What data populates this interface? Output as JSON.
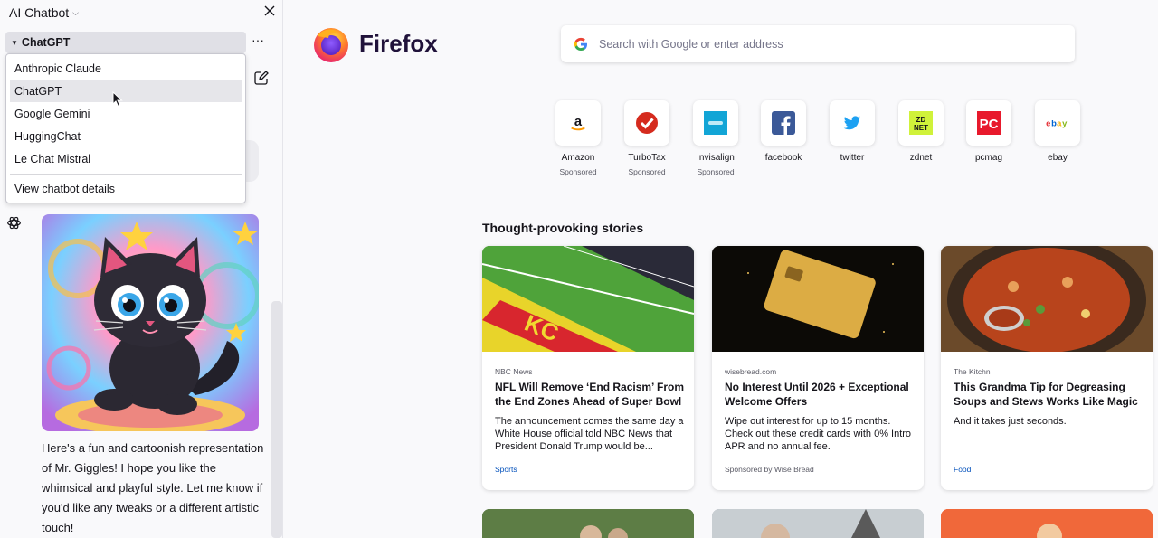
{
  "sidebar": {
    "title": "AI Chatbot",
    "selected_provider": "ChatGPT",
    "more_label": "···",
    "dropdown": {
      "items": [
        "Anthropic Claude",
        "ChatGPT",
        "Google Gemini",
        "HuggingChat",
        "Le Chat Mistral"
      ],
      "selected_index": 1,
      "details_label": "View chatbot details"
    },
    "reply_text": "Here's a fun and cartoonish representation of Mr. Giggles! I hope you like the whimsical and playful style. Let me know if you'd like any tweaks or a different artistic touch!"
  },
  "main": {
    "brand": "Firefox",
    "search_placeholder": "Search with Google or enter address",
    "shortcuts": [
      {
        "label": "Amazon",
        "sub": "Sponsored",
        "icon": "amazon-icon"
      },
      {
        "label": "TurboTax",
        "sub": "Sponsored",
        "icon": "turbotax-icon"
      },
      {
        "label": "Invisalign",
        "sub": "Sponsored",
        "icon": "invisalign-icon"
      },
      {
        "label": "facebook",
        "sub": "",
        "icon": "facebook-icon"
      },
      {
        "label": "twitter",
        "sub": "",
        "icon": "twitter-icon"
      },
      {
        "label": "zdnet",
        "sub": "",
        "icon": "zdnet-icon"
      },
      {
        "label": "pcmag",
        "sub": "",
        "icon": "pcmag-icon"
      },
      {
        "label": "ebay",
        "sub": "",
        "icon": "ebay-icon"
      }
    ],
    "stories_title": "Thought-provoking stories",
    "stories": [
      {
        "source": "NBC News",
        "title": "NFL Will Remove ‘End Racism’ From the End Zones Ahead of Super Bowl",
        "desc": "The announcement comes the same day a White House official told NBC News that President Donald Trump would be...",
        "footer": "Sports"
      },
      {
        "source": "wisebread.com",
        "title": "No Interest Until 2026 + Exceptional Welcome Offers",
        "desc": "Wipe out interest for up to 15 months. Check out these credit cards with 0% Intro APR and no annual fee.",
        "footer": "Sponsored by Wise Bread"
      },
      {
        "source": "The Kitchn",
        "title": "This Grandma Tip for Degreasing Soups and Stews Works Like Magic",
        "desc": "And it takes just seconds.",
        "footer": "Food"
      }
    ]
  },
  "colors": {
    "accent_blue": "#0250bb",
    "firefox_text": "#20123a"
  }
}
